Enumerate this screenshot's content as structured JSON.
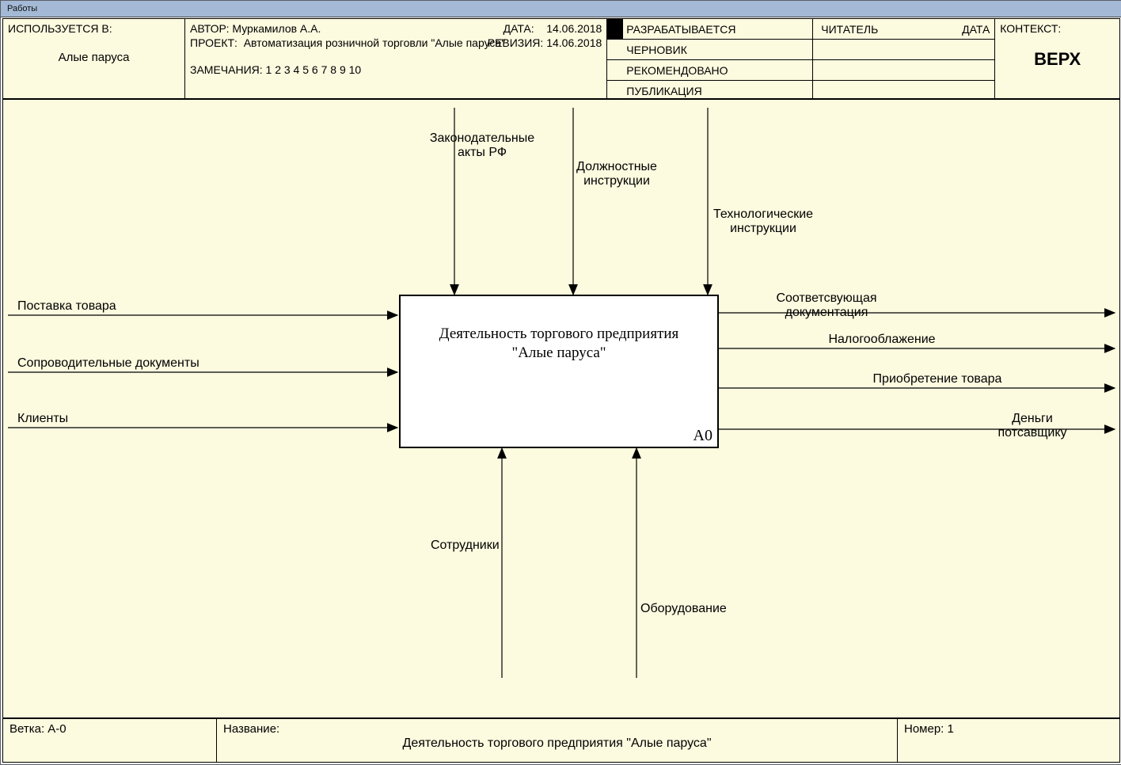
{
  "tab_title": "Работы",
  "header": {
    "used_in_label": "ИСПОЛЬЗУЕТСЯ В:",
    "used_in_value": "Алые паруса",
    "author_label": "АВТОР:",
    "author_value": "Муркамилов А.А.",
    "date_label": "ДАТА:",
    "date_value": "14.06.2018",
    "project_label": "ПРОЕКТ:",
    "project_value": "Автоматизация розничной торговли \"Алые паруса\"",
    "revision_label": "РЕВИЗИЯ:",
    "revision_value": "14.06.2018",
    "remarks_label": "ЗАМЕЧАНИЯ:",
    "remarks_value": "1 2 3 4 5 6 7 8 9 10",
    "status": {
      "developing": "РАЗРАБАТЫВАЕТСЯ",
      "draft": "ЧЕРНОВИК",
      "recommended": "РЕКОМЕНДОВАНО",
      "publication": "ПУБЛИКАЦИЯ"
    },
    "reader_label": "ЧИТАТЕЛЬ",
    "reader_date_label": "ДАТА",
    "context_label": "КОНТЕКСТ:",
    "context_value": "ВЕРХ"
  },
  "diagram": {
    "box_title_l1": "Деятельность торгового предприятия",
    "box_title_l2": "\"Алые паруса\"",
    "box_tag": "А0",
    "controls": {
      "c1": "Законодательные\nакты РФ",
      "c2": "Должностные\nинструкции",
      "c3": "Технологические\nинструкции"
    },
    "inputs": {
      "i1": "Поставка товара",
      "i2": "Сопроводительные документы",
      "i3": "Клиенты"
    },
    "outputs": {
      "o1": "Соответсвующая\nдокументация",
      "o2": "Налогооблажение",
      "o3": "Приобретение товара",
      "o4": "Деньги\nпотсавщику"
    },
    "mechanisms": {
      "m1": "Сотрудники",
      "m2": "Оборудование"
    }
  },
  "footer": {
    "branch_label": "Ветка:",
    "branch_value": "A-0",
    "name_label": "Название:",
    "name_value": "Деятельность торгового предприятия \"Алые паруса\"",
    "number_label": "Номер:",
    "number_value": "1"
  }
}
